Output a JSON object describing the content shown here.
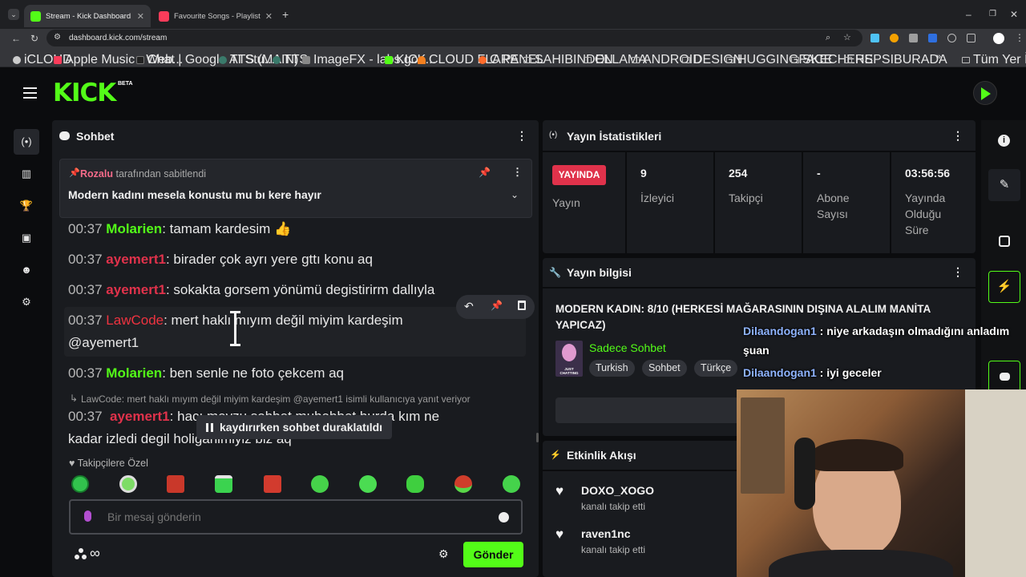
{
  "browser": {
    "tabs": [
      {
        "title": "Stream - Kick Dashboard",
        "icon": "kick-favicon"
      },
      {
        "title": "Favourite Songs - Playlist - App",
        "icon": "apple-music-favicon"
      }
    ],
    "new_tab": "+",
    "url": "dashboard.kick.com/stream",
    "bookmarks": [
      {
        "label": "iCLOUD"
      },
      {
        "label": "Apple Music - Web..."
      },
      {
        "label": "Chat | Google AI Stu..."
      },
      {
        "label": "TTS (MAIN)"
      },
      {
        "label": "TTS"
      },
      {
        "label": "ImageFX - labs.goo..."
      },
      {
        "label": "KICK"
      },
      {
        "label": "CLOUD FLARE"
      },
      {
        "label": "C PANEL"
      },
      {
        "label": "SAHIBINDEN"
      },
      {
        "label": "OLLAMA"
      },
      {
        "label": "ANDROID"
      },
      {
        "label": "DESIGN"
      },
      {
        "label": "HUGGINGFACE"
      },
      {
        "label": "SKECHERS"
      },
      {
        "label": "HEPSIBURADA"
      }
    ],
    "bookmarks_more": "»",
    "all_bookmarks": "Tüm Yer İşaretleri"
  },
  "kick": {
    "logo": "KICK",
    "beta": "BETA",
    "colors": {
      "brand": "#53fc18",
      "live": "#e0324b",
      "panel": "#191b1f"
    }
  },
  "chat": {
    "title": "Sohbet",
    "pinned": {
      "user": "Rozalu",
      "suffix": "tarafından sabitlendi",
      "message": "Modern kadını mesela konustu mu bı kere hayır"
    },
    "messages": [
      {
        "time": "00:37",
        "user": "Molarien",
        "text": ": tamam kardesim 👍"
      },
      {
        "time": "00:37",
        "user": "ayemert1",
        "text": ": birader çok ayrı yere gttı konu aq"
      },
      {
        "time": "00:37",
        "user": "ayemert1",
        "text": ": sokakta gorsem yönümü degistirirm dallıyla"
      },
      {
        "time": "00:37",
        "user": "LawCode",
        "text": ": mert haklı mıyım değil miyim kardeşim",
        "text2": "@ayemert1"
      },
      {
        "time": "00:37",
        "user": "Molarien",
        "text": ": ben senle ne foto çekcem aq"
      }
    ],
    "reply_context": "LawCode: mert haklı mıyım değil miyim kardeşim @ayemert1 isimli kullanıcıya yanıt veriyor",
    "reply_message": {
      "time": "00:37",
      "user": "ayemert1",
      "text": ": hacı mevzu sohbet muhabbet burda kım ne",
      "text2": "kadar izledi degil holiganimiyiz biz aq"
    },
    "paused_notice": "kaydırırken sohbet duraklatıldı",
    "followers_only": "Takipçilere Özel",
    "input_placeholder": "Bir mesaj gönderin",
    "send_label": "Gönder",
    "points_symbol": "∞"
  },
  "stats": {
    "title": "Yayın İstatistikleri",
    "live_badge": "YAYINDA",
    "live_label": "Yayın",
    "viewers_value": "9",
    "viewers_label": "İzleyici",
    "followers_value": "254",
    "followers_label": "Takipçi",
    "subs_value": "-",
    "subs_label_1": "Abone",
    "subs_label_2": "Sayısı",
    "duration_value": "03:56:56",
    "duration_label_1": "Yayında",
    "duration_label_2": "Olduğu",
    "duration_label_3": "Süre"
  },
  "stream_info": {
    "title": "Yayın bilgisi",
    "stream_title_1": "MODERN KADIN: 8/10 (HERKESİ MAĞARASININ DIŞINA ALALIM MANİTA",
    "stream_title_2": "YAPICAZ)",
    "category_thumb": "JUST CHATTING",
    "category": "Sadece Sohbet",
    "tags": [
      "Turkish",
      "Sohbet",
      "Türkçe"
    ]
  },
  "activity": {
    "title": "Etkinlik Akışı",
    "events": [
      {
        "user": "DOXO_XOGO",
        "action": "kanalı takip etti"
      },
      {
        "user": "raven1nc",
        "action": "kanalı takip etti"
      }
    ]
  },
  "overlay_chat": [
    {
      "user": "Dilaandogan1",
      "text": " : niye arkadaşın olmadığını anladım",
      "text2": "şuan"
    },
    {
      "user": "Dilaandogan1",
      "text": " : iyi geceler"
    }
  ]
}
